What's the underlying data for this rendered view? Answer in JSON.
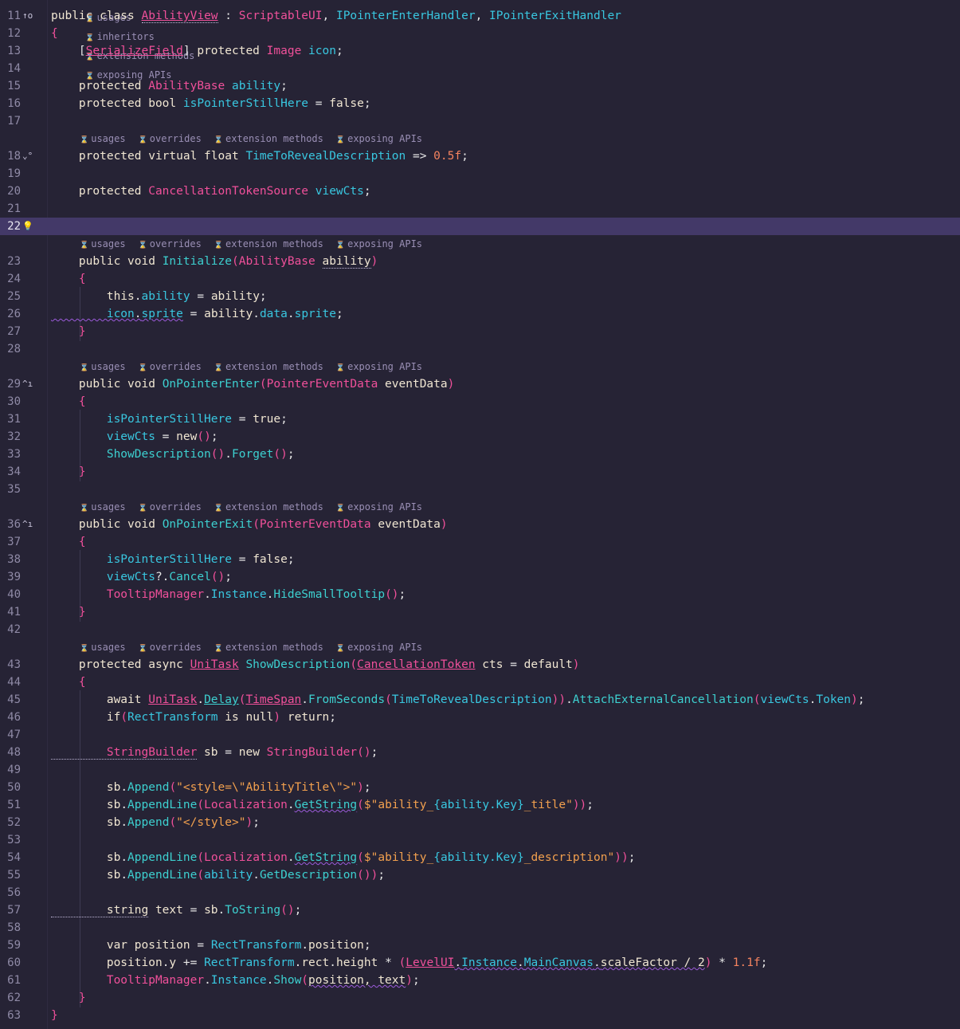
{
  "hint_labels": {
    "usages": "usages",
    "inheritors": "inheritors",
    "overrides": "overrides",
    "extension_methods": "extension methods",
    "exposing_apis": "exposing APIs"
  },
  "gutter_icons": {
    "11": "inheritors-icon",
    "18": "override-icon",
    "22": "lightbulb-icon",
    "29": "implements-icon",
    "36": "implements-icon"
  },
  "current_line": 22,
  "colors": {
    "background": "#262335",
    "current_line": "#433968",
    "keyword": "#f0e6d2",
    "type": "#f0509a",
    "member": "#39c7e0",
    "string": "#f2a04e",
    "number": "#f5835f"
  },
  "lines": [
    {
      "n": "11",
      "tokens": [
        [
          "k",
          "public class "
        ],
        [
          "t u dt",
          "AbilityView"
        ],
        [
          "p",
          " : "
        ],
        [
          "t",
          "ScriptableUI"
        ],
        [
          "p",
          ", "
        ],
        [
          "m",
          "IPointerEnterHandler"
        ],
        [
          "p",
          ", "
        ],
        [
          "m",
          "IPointerExitHandler"
        ]
      ]
    },
    {
      "n": "12",
      "tokens": [
        [
          "t",
          "{"
        ]
      ]
    },
    {
      "n": "13",
      "tokens": [
        [
          "p",
          "    ["
        ],
        [
          "t u",
          "SerializeField"
        ],
        [
          "p",
          "] "
        ],
        [
          "k",
          "protected "
        ],
        [
          "t",
          "Image "
        ],
        [
          "m",
          "icon"
        ],
        [
          "p",
          ";"
        ]
      ]
    },
    {
      "n": "14",
      "tokens": []
    },
    {
      "n": "15",
      "tokens": [
        [
          "k",
          "    protected "
        ],
        [
          "t",
          "AbilityBase "
        ],
        [
          "m",
          "ability"
        ],
        [
          "p",
          ";"
        ]
      ]
    },
    {
      "n": "16",
      "tokens": [
        [
          "k",
          "    protected bool "
        ],
        [
          "m",
          "isPointerStillHere"
        ],
        [
          "p",
          " = "
        ],
        [
          "k",
          "false"
        ],
        [
          "p",
          ";"
        ]
      ]
    },
    {
      "n": "17",
      "tokens": []
    },
    {
      "n": "18",
      "tokens": [
        [
          "k",
          "    protected virtual float "
        ],
        [
          "m",
          "TimeToRevealDescription"
        ],
        [
          "p",
          " => "
        ],
        [
          "n",
          "0.5f"
        ],
        [
          "p",
          ";"
        ]
      ]
    },
    {
      "n": "19",
      "tokens": []
    },
    {
      "n": "20",
      "tokens": [
        [
          "k",
          "    protected "
        ],
        [
          "t",
          "CancellationTokenSource "
        ],
        [
          "m",
          "viewCts"
        ],
        [
          "p",
          ";"
        ]
      ]
    },
    {
      "n": "21",
      "tokens": []
    },
    {
      "n": "22",
      "tokens": []
    },
    {
      "n": "23",
      "tokens": [
        [
          "k",
          "    public void "
        ],
        [
          "f",
          "Initialize"
        ],
        [
          "t",
          "("
        ],
        [
          "t",
          "AbilityBase "
        ],
        [
          "k dt",
          "ability"
        ],
        [
          "t",
          ")"
        ]
      ]
    },
    {
      "n": "24",
      "tokens": [
        [
          "t",
          "    {"
        ]
      ]
    },
    {
      "n": "25",
      "tokens": [
        [
          "k",
          "        this"
        ],
        [
          "p",
          "."
        ],
        [
          "m",
          "ability"
        ],
        [
          "p",
          " = "
        ],
        [
          "k",
          "ability"
        ],
        [
          "p",
          ";"
        ]
      ]
    },
    {
      "n": "26",
      "tokens": [
        [
          "m sq",
          "        icon"
        ],
        [
          "p sq",
          "."
        ],
        [
          "m sq",
          "sprite"
        ],
        [
          "p",
          " = "
        ],
        [
          "k",
          "ability"
        ],
        [
          "p",
          "."
        ],
        [
          "m",
          "data"
        ],
        [
          "p",
          "."
        ],
        [
          "m",
          "sprite"
        ],
        [
          "p",
          ";"
        ]
      ]
    },
    {
      "n": "27",
      "tokens": [
        [
          "t",
          "    }"
        ]
      ]
    },
    {
      "n": "28",
      "tokens": []
    },
    {
      "n": "29",
      "tokens": [
        [
          "k",
          "    public void "
        ],
        [
          "f",
          "OnPointerEnter"
        ],
        [
          "t",
          "("
        ],
        [
          "t",
          "PointerEventData "
        ],
        [
          "k",
          "eventData"
        ],
        [
          "t",
          ")"
        ]
      ]
    },
    {
      "n": "30",
      "tokens": [
        [
          "t",
          "    {"
        ]
      ]
    },
    {
      "n": "31",
      "tokens": [
        [
          "m",
          "        isPointerStillHere"
        ],
        [
          "p",
          " = "
        ],
        [
          "k",
          "true"
        ],
        [
          "p",
          ";"
        ]
      ]
    },
    {
      "n": "32",
      "tokens": [
        [
          "m",
          "        viewCts"
        ],
        [
          "p",
          " = "
        ],
        [
          "k",
          "new"
        ],
        [
          "t",
          "()"
        ],
        [
          "p",
          ";"
        ]
      ]
    },
    {
      "n": "33",
      "tokens": [
        [
          "f",
          "        ShowDescription"
        ],
        [
          "t",
          "()"
        ],
        [
          "p",
          "."
        ],
        [
          "f",
          "Forget"
        ],
        [
          "t",
          "()"
        ],
        [
          "p",
          ";"
        ]
      ]
    },
    {
      "n": "34",
      "tokens": [
        [
          "t",
          "    }"
        ]
      ]
    },
    {
      "n": "35",
      "tokens": []
    },
    {
      "n": "36",
      "tokens": [
        [
          "k",
          "    public void "
        ],
        [
          "f",
          "OnPointerExit"
        ],
        [
          "t",
          "("
        ],
        [
          "t",
          "PointerEventData "
        ],
        [
          "k",
          "eventData"
        ],
        [
          "t",
          ")"
        ]
      ]
    },
    {
      "n": "37",
      "tokens": [
        [
          "t",
          "    {"
        ]
      ]
    },
    {
      "n": "38",
      "tokens": [
        [
          "m",
          "        isPointerStillHere"
        ],
        [
          "p",
          " = "
        ],
        [
          "k",
          "false"
        ],
        [
          "p",
          ";"
        ]
      ]
    },
    {
      "n": "39",
      "tokens": [
        [
          "m",
          "        viewCts"
        ],
        [
          "p",
          "?."
        ],
        [
          "f",
          "Cancel"
        ],
        [
          "t",
          "()"
        ],
        [
          "p",
          ";"
        ]
      ]
    },
    {
      "n": "40",
      "tokens": [
        [
          "t",
          "        TooltipManager"
        ],
        [
          "p",
          "."
        ],
        [
          "m",
          "Instance"
        ],
        [
          "p",
          "."
        ],
        [
          "f",
          "HideSmallTooltip"
        ],
        [
          "t",
          "()"
        ],
        [
          "p",
          ";"
        ]
      ]
    },
    {
      "n": "41",
      "tokens": [
        [
          "t",
          "    }"
        ]
      ]
    },
    {
      "n": "42",
      "tokens": []
    },
    {
      "n": "43",
      "tokens": [
        [
          "k",
          "    protected async "
        ],
        [
          "t u",
          "UniTask"
        ],
        [
          "p",
          " "
        ],
        [
          "f",
          "ShowDescription"
        ],
        [
          "t",
          "("
        ],
        [
          "t u",
          "CancellationToken"
        ],
        [
          "k",
          " cts"
        ],
        [
          "p",
          " = "
        ],
        [
          "k",
          "default"
        ],
        [
          "t",
          ")"
        ]
      ]
    },
    {
      "n": "44",
      "tokens": [
        [
          "t",
          "    {"
        ]
      ]
    },
    {
      "n": "45",
      "tokens": [
        [
          "k",
          "        await "
        ],
        [
          "t u",
          "UniTask"
        ],
        [
          "p",
          "."
        ],
        [
          "f u",
          "Delay"
        ],
        [
          "t",
          "("
        ],
        [
          "t u",
          "TimeSpan"
        ],
        [
          "p",
          "."
        ],
        [
          "f",
          "FromSeconds"
        ],
        [
          "t",
          "("
        ],
        [
          "m",
          "TimeToRevealDescription"
        ],
        [
          "t",
          "))"
        ],
        [
          "p",
          "."
        ],
        [
          "f",
          "AttachExternalCancellation"
        ],
        [
          "t",
          "("
        ],
        [
          "m",
          "viewCts"
        ],
        [
          "p",
          "."
        ],
        [
          "m",
          "Token"
        ],
        [
          "t",
          ")"
        ],
        [
          "p",
          ";"
        ]
      ]
    },
    {
      "n": "46",
      "tokens": [
        [
          "k",
          "        if"
        ],
        [
          "t",
          "("
        ],
        [
          "m",
          "RectTransform"
        ],
        [
          "k",
          " is null"
        ],
        [
          "t",
          ")"
        ],
        [
          "k",
          " return"
        ],
        [
          "p",
          ";"
        ]
      ]
    },
    {
      "n": "47",
      "tokens": []
    },
    {
      "n": "48",
      "tokens": [
        [
          "t dt",
          "        StringBuilder"
        ],
        [
          "k",
          " sb"
        ],
        [
          "p",
          " = "
        ],
        [
          "k",
          "new "
        ],
        [
          "t",
          "StringBuilder"
        ],
        [
          "t",
          "()"
        ],
        [
          "p",
          ";"
        ]
      ]
    },
    {
      "n": "49",
      "tokens": []
    },
    {
      "n": "50",
      "tokens": [
        [
          "k",
          "        sb"
        ],
        [
          "p",
          "."
        ],
        [
          "f",
          "Append"
        ],
        [
          "t",
          "("
        ],
        [
          "s",
          "\"<style=\\\"AbilityTitle\\\">\""
        ],
        [
          "t",
          ")"
        ],
        [
          "p",
          ";"
        ]
      ]
    },
    {
      "n": "51",
      "tokens": [
        [
          "k",
          "        sb"
        ],
        [
          "p",
          "."
        ],
        [
          "f",
          "AppendLine"
        ],
        [
          "t",
          "("
        ],
        [
          "t",
          "Localization"
        ],
        [
          "p",
          "."
        ],
        [
          "f sq",
          "GetString"
        ],
        [
          "t",
          "("
        ],
        [
          "s",
          "$\"ability_"
        ],
        [
          "m",
          "{ability.Key}"
        ],
        [
          "s",
          "_title\""
        ],
        [
          "t",
          "))"
        ],
        [
          "p",
          ";"
        ]
      ]
    },
    {
      "n": "52",
      "tokens": [
        [
          "k",
          "        sb"
        ],
        [
          "p",
          "."
        ],
        [
          "f",
          "Append"
        ],
        [
          "t",
          "("
        ],
        [
          "s",
          "\"</style>\""
        ],
        [
          "t",
          ")"
        ],
        [
          "p",
          ";"
        ]
      ]
    },
    {
      "n": "53",
      "tokens": []
    },
    {
      "n": "54",
      "tokens": [
        [
          "k",
          "        sb"
        ],
        [
          "p",
          "."
        ],
        [
          "f",
          "AppendLine"
        ],
        [
          "t",
          "("
        ],
        [
          "t",
          "Localization"
        ],
        [
          "p",
          "."
        ],
        [
          "f sq",
          "GetString"
        ],
        [
          "t",
          "("
        ],
        [
          "s",
          "$\"ability_"
        ],
        [
          "m",
          "{ability.Key}"
        ],
        [
          "s",
          "_description\""
        ],
        [
          "t",
          "))"
        ],
        [
          "p",
          ";"
        ]
      ]
    },
    {
      "n": "55",
      "tokens": [
        [
          "k",
          "        sb"
        ],
        [
          "p",
          "."
        ],
        [
          "f",
          "AppendLine"
        ],
        [
          "t",
          "("
        ],
        [
          "m",
          "ability"
        ],
        [
          "p",
          "."
        ],
        [
          "f",
          "GetDescription"
        ],
        [
          "t",
          "())"
        ],
        [
          "p",
          ";"
        ]
      ]
    },
    {
      "n": "56",
      "tokens": []
    },
    {
      "n": "57",
      "tokens": [
        [
          "k dt",
          "        string"
        ],
        [
          "k",
          " text"
        ],
        [
          "p",
          " = "
        ],
        [
          "k",
          "sb"
        ],
        [
          "p",
          "."
        ],
        [
          "f",
          "ToString"
        ],
        [
          "t",
          "()"
        ],
        [
          "p",
          ";"
        ]
      ]
    },
    {
      "n": "58",
      "tokens": []
    },
    {
      "n": "59",
      "tokens": [
        [
          "k",
          "        var position"
        ],
        [
          "p",
          " = "
        ],
        [
          "m",
          "RectTransform"
        ],
        [
          "p",
          "."
        ],
        [
          "k",
          "position"
        ],
        [
          "p",
          ";"
        ]
      ]
    },
    {
      "n": "60",
      "tokens": [
        [
          "k",
          "        position"
        ],
        [
          "p",
          "."
        ],
        [
          "k",
          "y"
        ],
        [
          "p",
          " += "
        ],
        [
          "m",
          "RectTransform"
        ],
        [
          "p",
          "."
        ],
        [
          "k",
          "rect"
        ],
        [
          "p",
          "."
        ],
        [
          "k",
          "height"
        ],
        [
          "p",
          " * "
        ],
        [
          "t",
          "("
        ],
        [
          "t u",
          "LevelUI"
        ],
        [
          "p sq",
          "."
        ],
        [
          "m sq",
          "Instance"
        ],
        [
          "p sq",
          "."
        ],
        [
          "m sq",
          "MainCanvas"
        ],
        [
          "p sq",
          "."
        ],
        [
          "k sq",
          "scaleFactor / 2"
        ],
        [
          "t",
          ")"
        ],
        [
          "p",
          " * "
        ],
        [
          "n",
          "1.1f"
        ],
        [
          "p",
          ";"
        ]
      ]
    },
    {
      "n": "61",
      "tokens": [
        [
          "t",
          "        TooltipManager"
        ],
        [
          "p",
          "."
        ],
        [
          "m",
          "Instance"
        ],
        [
          "p",
          "."
        ],
        [
          "f",
          "Show"
        ],
        [
          "t",
          "("
        ],
        [
          "k sq",
          "position, text"
        ],
        [
          "t",
          ")"
        ],
        [
          "p",
          ";"
        ]
      ]
    },
    {
      "n": "62",
      "tokens": [
        [
          "t",
          "    }"
        ]
      ]
    },
    {
      "n": "63",
      "tokens": [
        [
          "t",
          "}"
        ]
      ]
    }
  ]
}
